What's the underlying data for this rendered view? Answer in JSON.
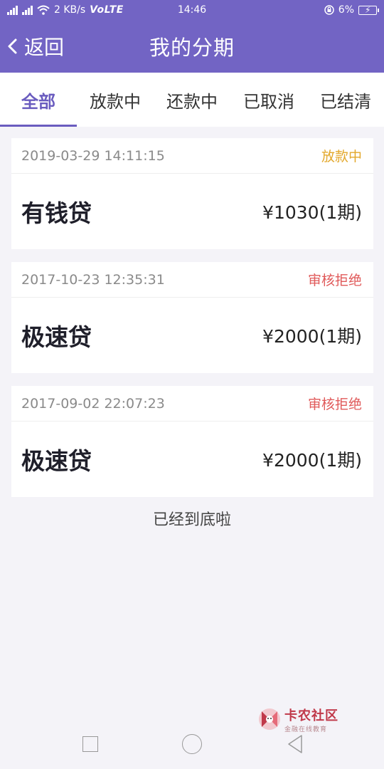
{
  "status_bar": {
    "network_label": "4G",
    "speed": "2 KB/s",
    "volte": "VoLTE",
    "time": "14:46",
    "battery": "6%"
  },
  "nav": {
    "back_label": "返回",
    "title": "我的分期"
  },
  "tabs": [
    {
      "label": "全部",
      "active": true
    },
    {
      "label": "放款中",
      "active": false
    },
    {
      "label": "还款中",
      "active": false
    },
    {
      "label": "已取消",
      "active": false
    },
    {
      "label": "已结清",
      "active": false
    }
  ],
  "orders": [
    {
      "date": "2019-03-29 14:11:15",
      "status": "放款中",
      "status_color": "#e3a82c",
      "name": "有钱贷",
      "amount": "¥1030(1期)"
    },
    {
      "date": "2017-10-23 12:35:31",
      "status": "审核拒绝",
      "status_color": "#e05a5a",
      "name": "极速贷",
      "amount": "¥2000(1期)"
    },
    {
      "date": "2017-09-02 22:07:23",
      "status": "审核拒绝",
      "status_color": "#e05a5a",
      "name": "极速贷",
      "amount": "¥2000(1期)"
    }
  ],
  "end_text": "已经到底啦",
  "watermark": {
    "main": "卡农社区",
    "sub": "金融在线教育"
  },
  "colors": {
    "primary": "#7264c4",
    "active_tab": "#6a5cbf"
  }
}
